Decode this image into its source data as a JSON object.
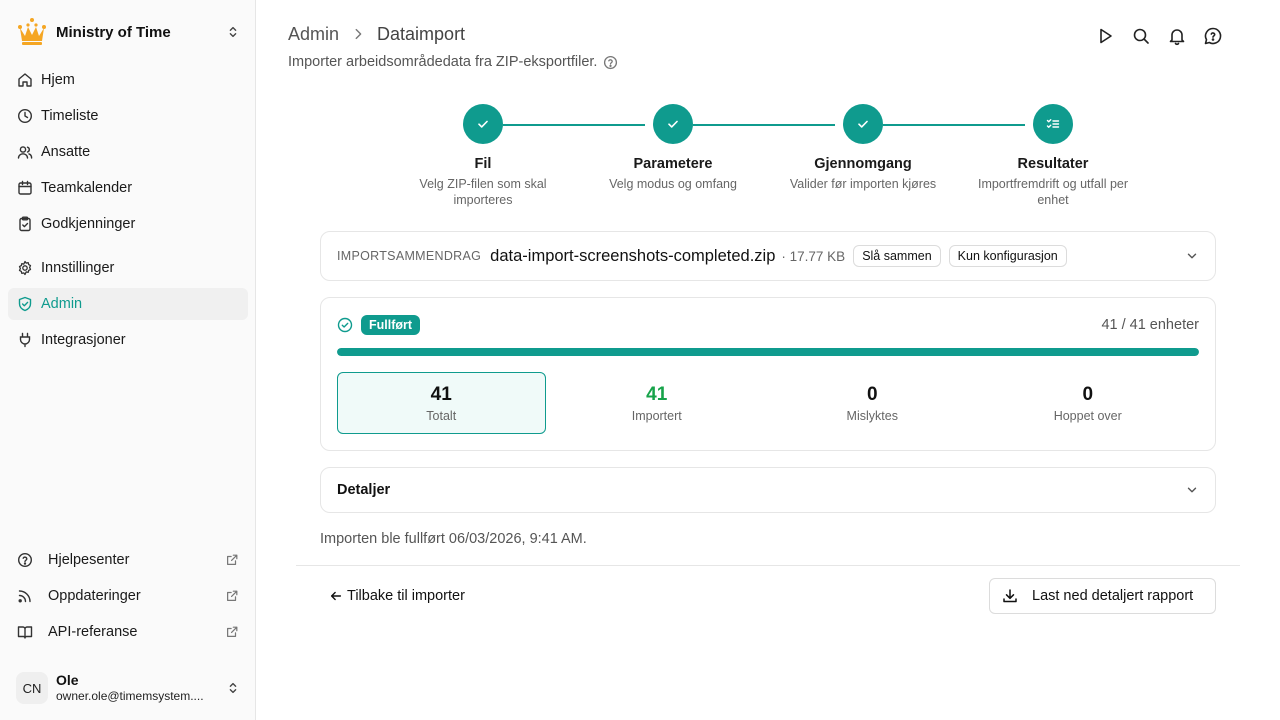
{
  "sidebar": {
    "brand": {
      "name": "Ministry of Time",
      "logo_icon": "crown-icon",
      "logo_color": "#f5a623"
    },
    "items": [
      {
        "label": "Hjem",
        "icon": "home-icon"
      },
      {
        "label": "Timeliste",
        "icon": "clock-icon"
      },
      {
        "label": "Ansatte",
        "icon": "users-icon"
      },
      {
        "label": "Teamkalender",
        "icon": "calendar-icon"
      },
      {
        "label": "Godkjenninger",
        "icon": "clipboard-check-icon"
      },
      {
        "label": "Innstillinger",
        "icon": "gear-icon"
      },
      {
        "label": "Admin",
        "icon": "shield-check-icon",
        "active": true
      },
      {
        "label": "Integrasjoner",
        "icon": "plug-icon"
      }
    ],
    "bottom_links": [
      {
        "label": "Hjelpesenter",
        "icon": "help-circle-icon"
      },
      {
        "label": "Oppdateringer",
        "icon": "rss-icon"
      },
      {
        "label": "API-referanse",
        "icon": "book-icon"
      }
    ],
    "user": {
      "initials": "CN",
      "name": "Ole",
      "email": "owner.ole@timemsystem...."
    }
  },
  "header": {
    "breadcrumb": {
      "parent": "Admin",
      "current": "Dataimport"
    },
    "subtitle": "Importer arbeidsområdedata fra ZIP-eksportfiler."
  },
  "top_actions": [
    "play-icon",
    "search-icon",
    "bell-icon",
    "message-help-icon"
  ],
  "stepper": [
    {
      "title": "Fil",
      "desc": "Velg ZIP-filen som skal importeres"
    },
    {
      "title": "Parametere",
      "desc": "Velg modus og omfang"
    },
    {
      "title": "Gjennomgang",
      "desc": "Valider før importen kjøres"
    },
    {
      "title": "Resultater",
      "desc": "Importfremdrift og utfall per enhet"
    }
  ],
  "summary": {
    "label": "IMPORTSAMMENDRAG",
    "file": "data-import-screenshots-completed.zip",
    "size": "· 17.77 KB",
    "tags": [
      "Slå sammen",
      "Kun konfigurasjon"
    ]
  },
  "result": {
    "status": "Fullført",
    "units": "41 / 41 enheter",
    "progress": 1.0,
    "stats": [
      {
        "value": "41",
        "label": "Totalt"
      },
      {
        "value": "41",
        "label": "Importert"
      },
      {
        "value": "0",
        "label": "Mislyktes"
      },
      {
        "value": "0",
        "label": "Hoppet over"
      }
    ]
  },
  "details": {
    "title": "Detaljer"
  },
  "completed_text": "Importen ble fullført 06/03/2026, 9:41 AM.",
  "footer": {
    "back": "Tilbake til importer",
    "download": "Last ned detaljert rapport"
  },
  "colors": {
    "accent": "#0f9b8e",
    "success": "#17a34a",
    "brand": "#f5a623"
  }
}
